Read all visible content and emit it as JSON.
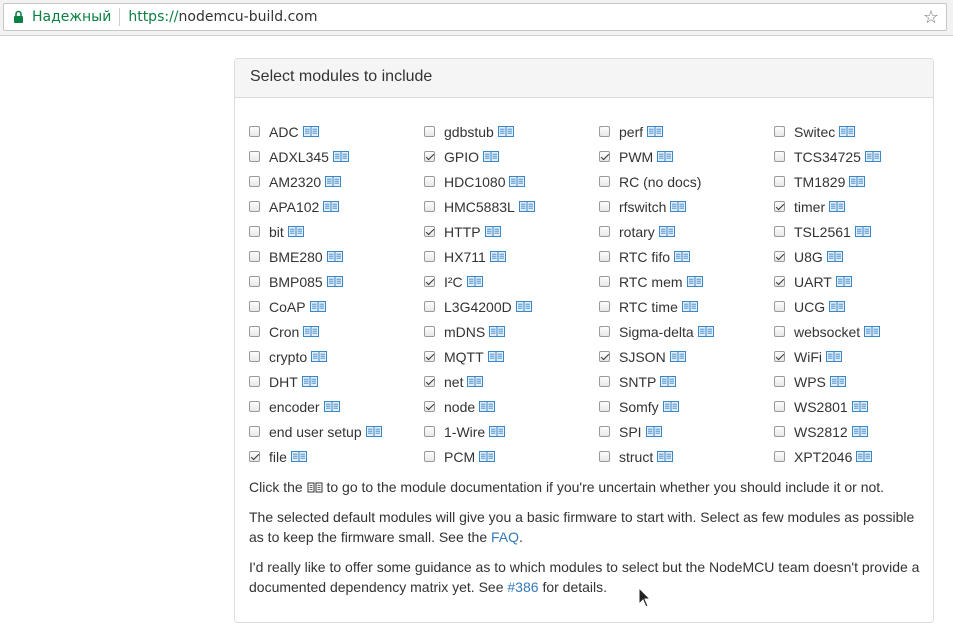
{
  "browser": {
    "secure_label": "Надежный",
    "url_scheme": "https://",
    "url_host": "nodemcu-build.com"
  },
  "panel": {
    "title": "Select modules to include"
  },
  "modules": [
    [
      {
        "label": "ADC",
        "checked": false
      },
      {
        "label": "ADXL345",
        "checked": false
      },
      {
        "label": "AM2320",
        "checked": false
      },
      {
        "label": "APA102",
        "checked": false
      },
      {
        "label": "bit",
        "checked": false
      },
      {
        "label": "BME280",
        "checked": false
      },
      {
        "label": "BMP085",
        "checked": false
      },
      {
        "label": "CoAP",
        "checked": false
      },
      {
        "label": "Cron",
        "checked": false
      },
      {
        "label": "crypto",
        "checked": false
      },
      {
        "label": "DHT",
        "checked": false
      },
      {
        "label": "encoder",
        "checked": false
      },
      {
        "label": "end user setup",
        "checked": false
      },
      {
        "label": "file",
        "checked": true
      }
    ],
    [
      {
        "label": "gdbstub",
        "checked": false
      },
      {
        "label": "GPIO",
        "checked": true
      },
      {
        "label": "HDC1080",
        "checked": false
      },
      {
        "label": "HMC5883L",
        "checked": false
      },
      {
        "label": "HTTP",
        "checked": true
      },
      {
        "label": "HX711",
        "checked": false
      },
      {
        "label": "I²C",
        "checked": true
      },
      {
        "label": "L3G4200D",
        "checked": false
      },
      {
        "label": "mDNS",
        "checked": false
      },
      {
        "label": "MQTT",
        "checked": true
      },
      {
        "label": "net",
        "checked": true
      },
      {
        "label": "node",
        "checked": true
      },
      {
        "label": "1-Wire",
        "checked": false
      },
      {
        "label": "PCM",
        "checked": false
      }
    ],
    [
      {
        "label": "perf",
        "checked": false
      },
      {
        "label": "PWM",
        "checked": true
      },
      {
        "label": "RC (no docs)",
        "checked": false,
        "no_doc": true
      },
      {
        "label": "rfswitch",
        "checked": false
      },
      {
        "label": "rotary",
        "checked": false
      },
      {
        "label": "RTC fifo",
        "checked": false
      },
      {
        "label": "RTC mem",
        "checked": false
      },
      {
        "label": "RTC time",
        "checked": false
      },
      {
        "label": "Sigma-delta",
        "checked": false
      },
      {
        "label": "SJSON",
        "checked": true
      },
      {
        "label": "SNTP",
        "checked": false
      },
      {
        "label": "Somfy",
        "checked": false
      },
      {
        "label": "SPI",
        "checked": false
      },
      {
        "label": "struct",
        "checked": false
      }
    ],
    [
      {
        "label": "Switec",
        "checked": false
      },
      {
        "label": "TCS34725",
        "checked": false
      },
      {
        "label": "TM1829",
        "checked": false
      },
      {
        "label": "timer",
        "checked": true
      },
      {
        "label": "TSL2561",
        "checked": false
      },
      {
        "label": "U8G",
        "checked": true
      },
      {
        "label": "UART",
        "checked": true
      },
      {
        "label": "UCG",
        "checked": false
      },
      {
        "label": "websocket",
        "checked": false
      },
      {
        "label": "WiFi",
        "checked": true
      },
      {
        "label": "WPS",
        "checked": false
      },
      {
        "label": "WS2801",
        "checked": false
      },
      {
        "label": "WS2812",
        "checked": false
      },
      {
        "label": "XPT2046",
        "checked": false
      }
    ]
  ],
  "help": {
    "p1_before": "Click the",
    "p1_after": "to go to the module documentation if you're uncertain whether you should include it or not.",
    "p2_before": "The selected default modules will give you a basic firmware to start with. Select as few modules as possible as to keep the firmware small. See the",
    "p2_link": "FAQ",
    "p2_after": ".",
    "p3_before": "I'd really like to offer some guidance as to which modules to select but the NodeMCU team doesn't provide a documented dependency matrix yet. See",
    "p3_link": "#386",
    "p3_after": "for details."
  },
  "colors": {
    "secure_green": "#0b8043",
    "link_blue": "#337ab7",
    "doc_icon_blue": "#3a86c8"
  },
  "icons": {
    "doc": "book-icon",
    "lock": "lock-icon",
    "star": "star-icon",
    "cursor": "cursor-icon"
  }
}
